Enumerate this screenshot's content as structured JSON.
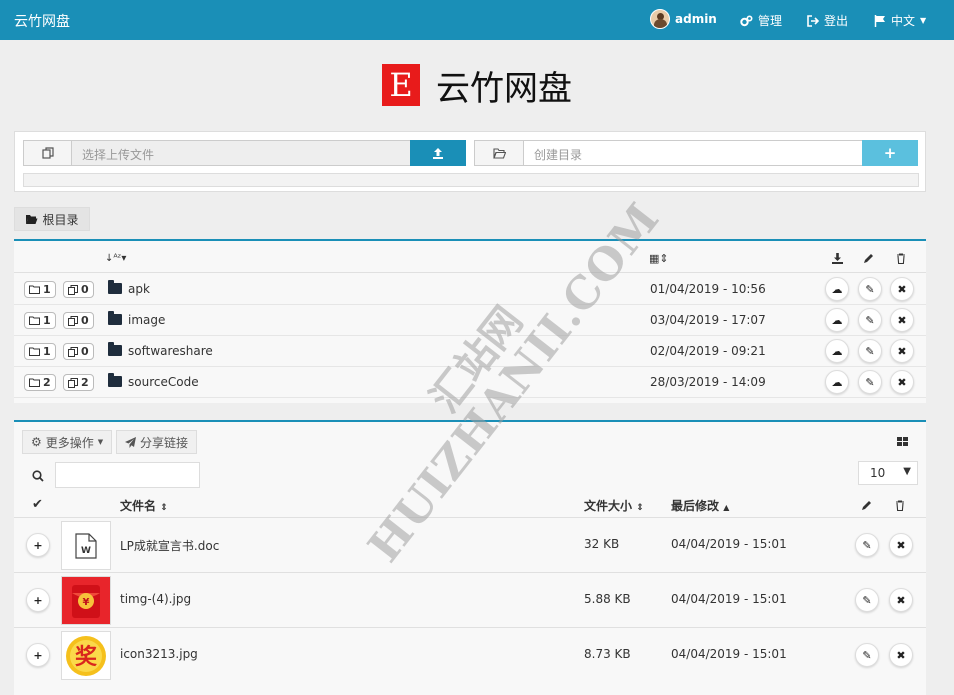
{
  "navbar": {
    "brand": "云竹网盘",
    "user": "admin",
    "manage": "管理",
    "logout": "登出",
    "language": "中文"
  },
  "hero": {
    "logo_letter": "E",
    "title": "云竹网盘"
  },
  "upload": {
    "file_placeholder": "选择上传文件",
    "dir_placeholder": "创建目录",
    "add_symbol": "+"
  },
  "breadcrumb": {
    "root": "根目录"
  },
  "directories": [
    {
      "dirs": "1",
      "files": "0",
      "name": "apk",
      "date": "01/04/2019 - 10:56"
    },
    {
      "dirs": "1",
      "files": "0",
      "name": "image",
      "date": "03/04/2019 - 17:07"
    },
    {
      "dirs": "1",
      "files": "0",
      "name": "softwareshare",
      "date": "02/04/2019 - 09:21"
    },
    {
      "dirs": "2",
      "files": "2",
      "name": "sourceCode",
      "date": "28/03/2019 - 14:09"
    }
  ],
  "file_toolbar": {
    "more_actions": "更多操作",
    "share_link": "分享链接",
    "page_size": "10"
  },
  "file_table": {
    "headers": {
      "name": "文件名",
      "size": "文件大小",
      "modified": "最后修改"
    },
    "rows": [
      {
        "name": "LP成就宣言书.doc",
        "size": "32 KB",
        "modified": "04/04/2019 - 15:01",
        "thumb": "word-doc-icon"
      },
      {
        "name": "timg-(4).jpg",
        "size": "5.88 KB",
        "modified": "04/04/2019 - 15:01",
        "thumb": "red-envelope-image"
      },
      {
        "name": "icon3213.jpg",
        "size": "8.73 KB",
        "modified": "04/04/2019 - 15:01",
        "thumb": "prize-badge-image"
      }
    ]
  },
  "watermark": {
    "line1": "汇站网",
    "line2": "HUIZHANII.COM"
  },
  "colors": {
    "primary": "#1a8fb7",
    "light_blue": "#5bc0de",
    "logo_red": "#e81b1b"
  }
}
